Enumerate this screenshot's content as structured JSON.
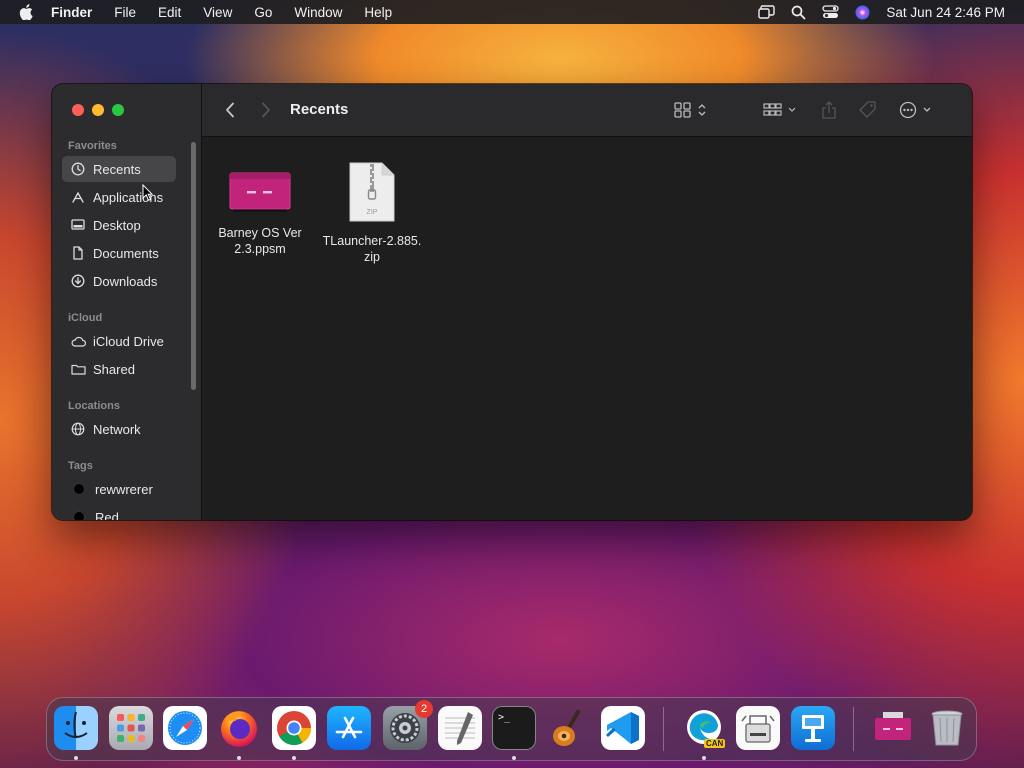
{
  "menubar": {
    "app_name": "Finder",
    "menus": [
      "File",
      "Edit",
      "View",
      "Go",
      "Window",
      "Help"
    ],
    "clock": "Sat Jun 24  2:46 PM"
  },
  "window": {
    "title": "Recents",
    "sidebar": {
      "favorites_header": "Favorites",
      "favorites": [
        {
          "label": "Recents",
          "icon": "clock-icon",
          "selected": true
        },
        {
          "label": "Applications",
          "icon": "applications-icon"
        },
        {
          "label": "Desktop",
          "icon": "desktop-icon"
        },
        {
          "label": "Documents",
          "icon": "document-icon"
        },
        {
          "label": "Downloads",
          "icon": "download-icon"
        }
      ],
      "icloud_header": "iCloud",
      "icloud": [
        {
          "label": "iCloud Drive",
          "icon": "cloud-icon"
        },
        {
          "label": "Shared",
          "icon": "shared-folder-icon"
        }
      ],
      "locations_header": "Locations",
      "locations": [
        {
          "label": "Network",
          "icon": "globe-icon"
        }
      ],
      "tags_header": "Tags",
      "tags": [
        {
          "label": "rewwrerer",
          "color": "#000000"
        },
        {
          "label": "Red",
          "color": "#000000"
        }
      ]
    },
    "files": [
      {
        "name_line1": "Barney OS Ver",
        "name_line2": "2.3.ppsm",
        "icon": "powerpoint-show-icon",
        "color": "#c2247c"
      },
      {
        "name_line1": "TLauncher-2.885.",
        "name_line2": "zip",
        "icon": "zip-file-icon",
        "badge": "ZIP"
      }
    ]
  },
  "dock": {
    "apps": [
      "Finder",
      "Launchpad",
      "Safari",
      "Firefox",
      "Chrome",
      "App Store",
      "System Settings",
      "TextEdit",
      "Terminal",
      "GarageBand",
      "Visual Studio Code",
      "Microsoft Edge Canary",
      "Archive Utility",
      "Keynote"
    ],
    "settings_badge": "2",
    "edge_label": "CAN",
    "terminal_prompt": ">_"
  },
  "colors": {
    "accent_pink": "#c2247c",
    "traffic_close": "#fe5f57",
    "traffic_min": "#febc2e",
    "traffic_max": "#28c840"
  }
}
